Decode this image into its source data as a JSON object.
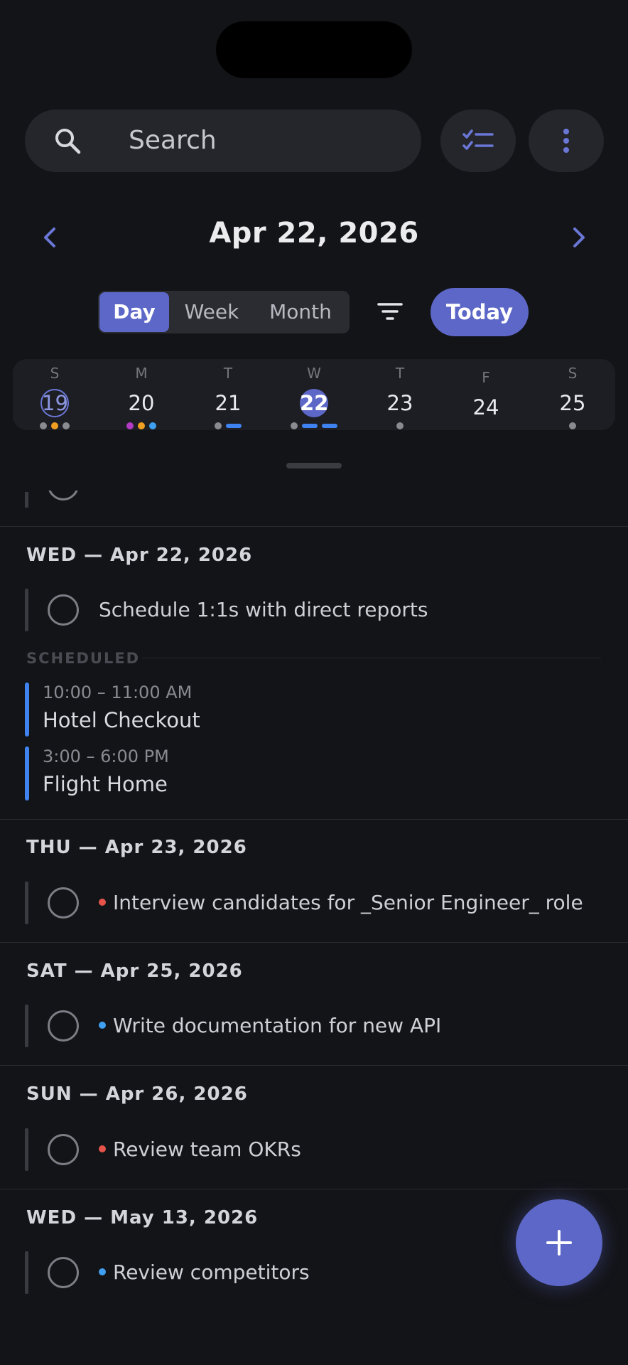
{
  "search": {
    "placeholder": "Search",
    "icon": "search-icon"
  },
  "toolbar": {
    "checklist_icon": "checklist-icon",
    "more_icon": "more-vertical-icon"
  },
  "header": {
    "date": "Apr 22, 2026",
    "prev_icon": "chevron-left-icon",
    "next_icon": "chevron-right-icon"
  },
  "view_modes": {
    "day": "Day",
    "week": "Week",
    "month": "Month",
    "selected": "Day"
  },
  "filter_icon": "filter-icon",
  "today_label": "Today",
  "week_days": [
    {
      "letter": "S",
      "num": "19",
      "state": "today-ring"
    },
    {
      "letter": "M",
      "num": "20",
      "state": "normal"
    },
    {
      "letter": "T",
      "num": "21",
      "state": "normal"
    },
    {
      "letter": "W",
      "num": "22",
      "state": "selected"
    },
    {
      "letter": "T",
      "num": "23",
      "state": "normal"
    },
    {
      "letter": "F",
      "num": "24",
      "state": "normal"
    },
    {
      "letter": "S",
      "num": "25",
      "state": "normal"
    }
  ],
  "colors": {
    "accent": "#5c67c7",
    "event_blue": "#3f83f1",
    "priority_red": "#e5534b",
    "priority_blue": "#3fa0f1",
    "dot_gray": "#8a8b90",
    "dot_orange": "#f0a020",
    "dot_purple": "#b23bc4"
  },
  "sections": [
    {
      "title": "WED — Apr 22, 2026",
      "tasks": [
        {
          "label": "Schedule 1:1s with direct reports",
          "priority": ""
        }
      ]
    },
    {
      "title": "THU — Apr 23, 2026",
      "tasks": [
        {
          "label": "Interview candidates for _Senior Engineer_ role",
          "priority": "red"
        }
      ]
    },
    {
      "title": "SAT — Apr 25, 2026",
      "tasks": [
        {
          "label": "Write documentation for new API",
          "priority": "blue"
        }
      ]
    },
    {
      "title": "SUN — Apr 26, 2026",
      "tasks": [
        {
          "label": "Review team OKRs",
          "priority": "red"
        }
      ]
    },
    {
      "title": "WED — May 13, 2026",
      "tasks": [
        {
          "label": "Review competitors",
          "priority": "blue"
        }
      ]
    }
  ],
  "scheduled": {
    "label": "SCHEDULED",
    "events": [
      {
        "time": "10:00 – 11:00 AM",
        "title": "Hotel Checkout"
      },
      {
        "time": "3:00 – 6:00 PM",
        "title": "Flight Home"
      }
    ]
  },
  "fab_icon": "plus-icon"
}
